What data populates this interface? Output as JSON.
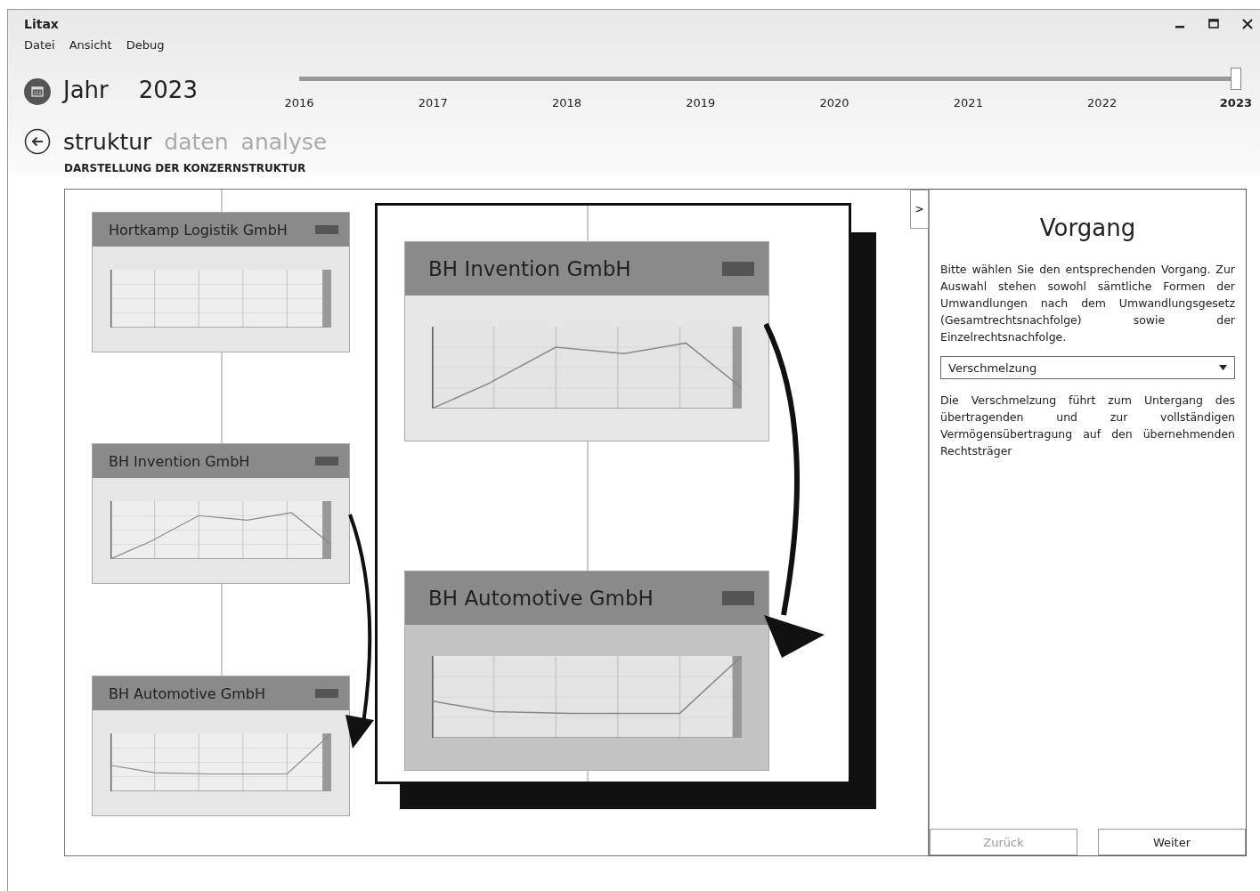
{
  "window": {
    "title": "Litax"
  },
  "menu": [
    "Datei",
    "Ansicht",
    "Debug"
  ],
  "year": {
    "label": "Jahr",
    "value": "2023",
    "level": 1,
    "ticks": [
      {
        "label": "2016",
        "selected": false
      },
      {
        "label": "2017",
        "selected": false
      },
      {
        "label": "2018",
        "selected": false
      },
      {
        "label": "2019",
        "selected": false
      },
      {
        "label": "2020",
        "selected": false
      },
      {
        "label": "2021",
        "selected": false
      },
      {
        "label": "2022",
        "selected": false
      },
      {
        "label": "2023",
        "selected": true
      }
    ]
  },
  "nav": {
    "tabs": [
      {
        "label": "struktur",
        "selected": true
      },
      {
        "label": "daten",
        "selected": false
      },
      {
        "label": "analyse",
        "selected": false
      }
    ],
    "subtitle": "DARSTELLUNG DER KONZERNSTRUKTUR"
  },
  "diagram": {
    "nodes": [
      {
        "title": "Hortkamp Logistik GmbH",
        "kind": "empty"
      },
      {
        "title": "BH Invention GmbH",
        "kind": "wave"
      },
      {
        "title": "BH Automotive GmbH",
        "kind": "rise"
      }
    ],
    "focus": {
      "nodes": [
        {
          "title": "BH Invention GmbH",
          "kind": "wave"
        },
        {
          "title": "BH Automotive GmbH",
          "kind": "rise"
        }
      ]
    }
  },
  "panel": {
    "toggle": ">",
    "title": "Vorgang",
    "intro": "Bitte wählen Sie den entsprechenden Vorgang. Zur Auswahl stehen sowohl sämtliche Formen der Umwandlungen nach dem Umwandlungsgesetz (Gesamtrechtsnachfolge) sowie der Einzelrechtsnachfolge.",
    "dropdown": {
      "value": "Verschmelzung"
    },
    "description": "Die Verschmelzung führt zum Untergang des übertragenden und zur vollständigen Vermögensübertragung auf den übernehmenden Rechtsträger",
    "buttons": [
      {
        "label": "Zurück",
        "disabled": true
      },
      {
        "label": "Weiter",
        "disabled": false
      }
    ]
  }
}
